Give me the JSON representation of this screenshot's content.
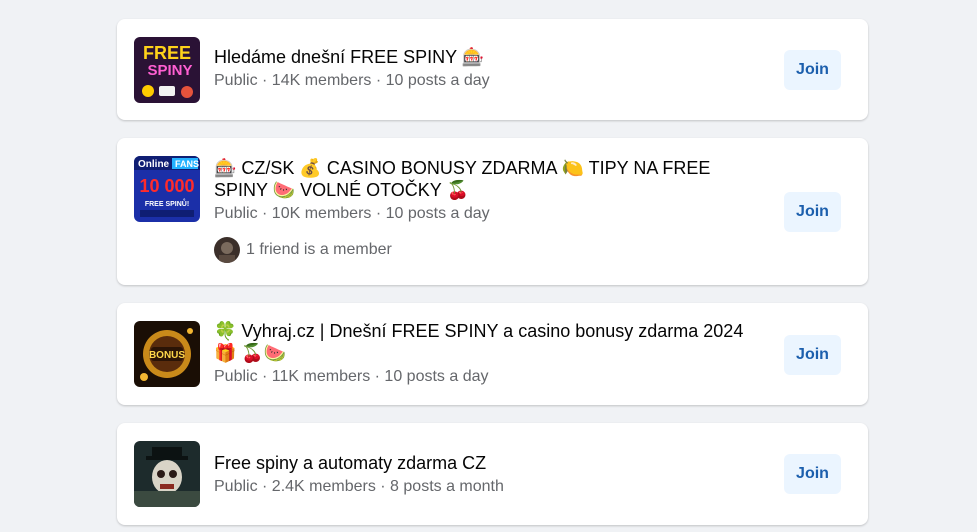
{
  "groups": [
    {
      "title": "Hledáme dnešní FREE SPINY 🎰",
      "meta": "Public · 14K members · 10 posts a day",
      "join_label": "Join",
      "thumb_text": "FREE SPINY"
    },
    {
      "title": "🎰 CZ/SK 💰 CASINO BONUSY ZDARMA 🍋 TIPY NA FREE SPINY 🍉 VOLNÉ OTOČKY 🍒",
      "meta": "Public · 10K members · 10 posts a day",
      "friend_text": "1 friend is a member",
      "join_label": "Join",
      "thumb_text": "OnlineFANS 10 000"
    },
    {
      "title": "🍀 Vyhraj.cz | Dnešní FREE SPINY a casino bonusy zdarma 2024 🎁 🍒🍉",
      "meta": "Public · 11K members · 10 posts a day",
      "join_label": "Join",
      "thumb_text": "BONUS"
    },
    {
      "title": "Free spiny a automaty zdarma CZ",
      "meta": "Public · 2.4K members · 8 posts a month",
      "join_label": "Join"
    }
  ]
}
